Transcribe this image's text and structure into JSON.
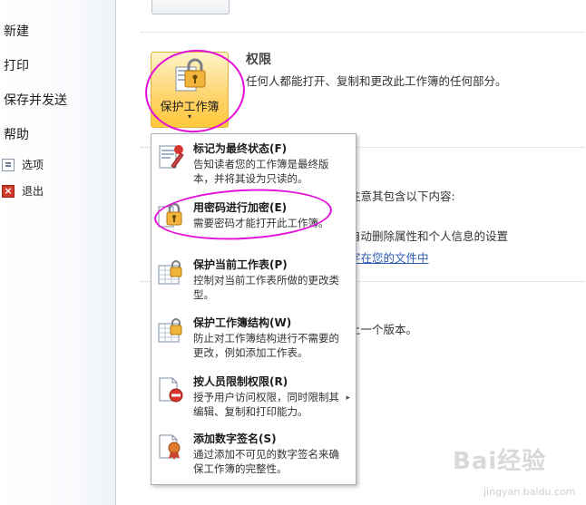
{
  "sidebar": {
    "items": [
      {
        "label": "新建"
      },
      {
        "label": "打印"
      },
      {
        "label": "保存并发送"
      },
      {
        "label": "帮助"
      }
    ],
    "options_label": "选项",
    "exit_label": "退出"
  },
  "protect": {
    "button_label": "保护工作簿",
    "arrow": "▾",
    "section_title": "权限",
    "section_desc": "任何人都能打开、复制和更改此工作簿的任何部分。"
  },
  "background": {
    "line1": "注意其包含以下内容:",
    "line2": "自动删除属性和个人信息的设置",
    "link": "字在您的文件中",
    "line3": "上一个版本。"
  },
  "menu": {
    "items": [
      {
        "title": "标记为最终状态(F)",
        "desc": "告知读者您的工作簿是最终版本，并将其设为只读的。"
      },
      {
        "title": "用密码进行加密(E)",
        "desc": "需要密码才能打开此工作簿。"
      },
      {
        "title": "保护当前工作表(P)",
        "desc": "控制对当前工作表所做的更改类型。"
      },
      {
        "title": "保护工作簿结构(W)",
        "desc": "防止对工作簿结构进行不需要的更改，例如添加工作表。"
      },
      {
        "title": "按人员限制权限(R)",
        "desc": "授予用户访问权限，同时限制其编辑、复制和打印能力。"
      },
      {
        "title": "添加数字签名(S)",
        "desc": "通过添加不可见的数字签名来确保工作簿的完整性。"
      }
    ],
    "submenu_arrow": "▸"
  },
  "watermark": {
    "brand": "Bai经验",
    "url": "jingyan.baidu.com"
  },
  "colors": {
    "highlight_ring": "#e40fd8",
    "protect_button": "#ffd36c",
    "link": "#2a5bb0"
  }
}
